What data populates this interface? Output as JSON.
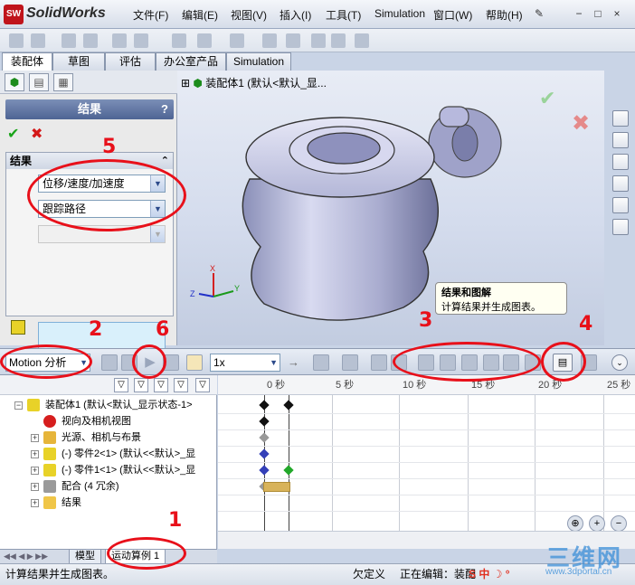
{
  "app": {
    "logo_text": "SolidWorks",
    "logo_badge": "SW"
  },
  "menu": [
    "文件(F)",
    "编辑(E)",
    "视图(V)",
    "插入(I)",
    "工具(T)",
    "Simulation",
    "窗口(W)",
    "帮助(H)"
  ],
  "window_controls": [
    "−",
    "□",
    "×"
  ],
  "tabs": [
    "装配体",
    "草图",
    "评估",
    "办公室产品",
    "Simulation"
  ],
  "property_manager": {
    "title": "结果",
    "help": "?",
    "group_title": "结果",
    "select1": "位移/速度/加速度",
    "select2": "跟踪路径",
    "select3": ""
  },
  "graphics": {
    "tree_root": "装配体1  (默认<默认_显...",
    "axis_x": "X",
    "axis_y": "Y",
    "axis_z": "Z"
  },
  "tooltip": {
    "title": "结果和图解",
    "body": "计算结果并生成图表。"
  },
  "motion": {
    "study_type": "Motion 分析",
    "speed": "1x"
  },
  "tree_rows": [
    {
      "label": "装配体1  (默认<默认_显示状态-1>"
    },
    {
      "label": "视向及相机视图"
    },
    {
      "label": "光源、相机与布景"
    },
    {
      "label": "(-) 零件2<1> (默认<<默认>_显"
    },
    {
      "label": "(-) 零件1<1> (默认<<默认>_显"
    },
    {
      "label": "配合  (4 冗余)"
    },
    {
      "label": "结果"
    }
  ],
  "timeline": {
    "labels": [
      "0 秒",
      "5 秒",
      "10 秒",
      "15 秒",
      "20 秒",
      "25 秒"
    ]
  },
  "bottom_tabs": [
    "模型",
    "运动算例 1"
  ],
  "status": {
    "left": "计算结果并生成图表。",
    "mid1": "欠定义",
    "mid2": "正在编辑：装配"
  },
  "annotations": [
    "1",
    "2",
    "3",
    "4",
    "5",
    "6"
  ],
  "watermark": {
    "big": "三维网",
    "small": "www.3dportal.cn"
  }
}
